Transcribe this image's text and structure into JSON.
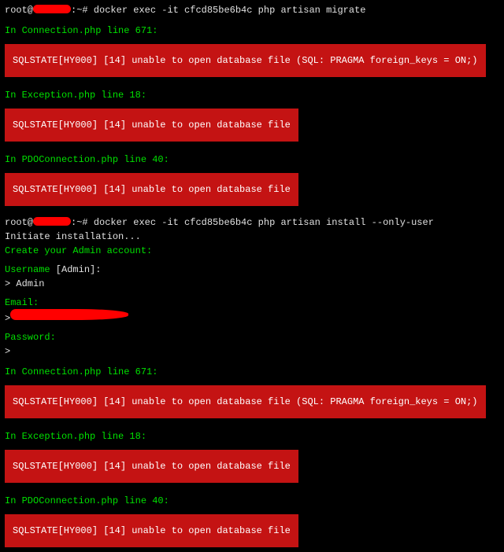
{
  "prompt1": {
    "user": "root@",
    "host_suffix": ":~# ",
    "command": "docker exec -it cfcd85be6b4c php artisan migrate"
  },
  "errors1": [
    {
      "header": "In Connection.php line 671:",
      "message": "SQLSTATE[HY000] [14] unable to open database file (SQL: PRAGMA foreign_keys = ON;)"
    },
    {
      "header": "In Exception.php line 18:",
      "message": "SQLSTATE[HY000] [14] unable to open database file"
    },
    {
      "header": "In PDOConnection.php line 40:",
      "message": "SQLSTATE[HY000] [14] unable to open database file"
    }
  ],
  "prompt2": {
    "user": "root@",
    "host_suffix": ":~# ",
    "command": "docker exec -it cfcd85be6b4c php artisan install --only-user"
  },
  "install": {
    "initiate": "Initiate installation...",
    "create_admin": "Create your Admin account:",
    "username_label": "Username",
    "username_default": " [Admin]:",
    "username_value": "> Admin",
    "email_label": "Email:",
    "email_prompt": ">",
    "password_label": "Password:",
    "password_prompt": ">"
  },
  "errors2": [
    {
      "header": "In Connection.php line 671:",
      "message": "SQLSTATE[HY000] [14] unable to open database file (SQL: PRAGMA foreign_keys = ON;)"
    },
    {
      "header": "In Exception.php line 18:",
      "message": "SQLSTATE[HY000] [14] unable to open database file"
    },
    {
      "header": "In PDOConnection.php line 40:",
      "message": "SQLSTATE[HY000] [14] unable to open database file"
    }
  ]
}
